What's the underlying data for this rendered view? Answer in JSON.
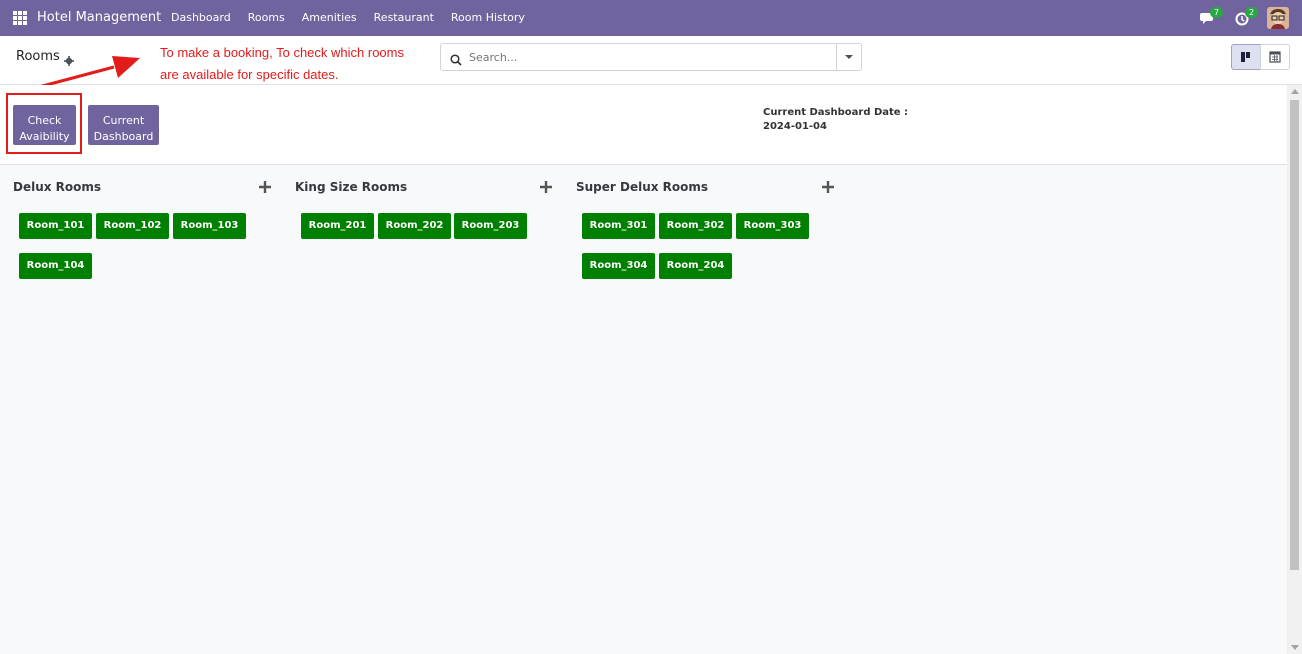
{
  "navbar": {
    "brand": "Hotel Management",
    "menu": [
      "Dashboard",
      "Rooms",
      "Amenities",
      "Restaurant",
      "Room History"
    ],
    "chat_badge": "7",
    "activity_badge": "2",
    "color": "#71639e"
  },
  "control": {
    "breadcrumb": "Rooms",
    "annotation_line1": "To make a booking, To check which rooms",
    "annotation_line2": "are available for specific dates.",
    "search_placeholder": "Search..."
  },
  "toolbar": {
    "check_label_1": "Check",
    "check_label_2": "Avaibility",
    "dashboard_label_1": "Current",
    "dashboard_label_2": "Dashboard",
    "date_label": "Current Dashboard Date :",
    "date_value": "2024-01-04"
  },
  "groups": [
    {
      "title": "Delux Rooms",
      "rooms": [
        "Room_101",
        "Room_102",
        "Room_103",
        "Room_104"
      ]
    },
    {
      "title": "King Size Rooms",
      "rooms": [
        "Room_201",
        "Room_202",
        "Room_203"
      ]
    },
    {
      "title": "Super Delux Rooms",
      "rooms": [
        "Room_301",
        "Room_302",
        "Room_303",
        "Room_304",
        "Room_204"
      ]
    }
  ],
  "colors": {
    "accent": "#71639e",
    "room_available": "#008000",
    "annotation": "#e31b1b"
  }
}
